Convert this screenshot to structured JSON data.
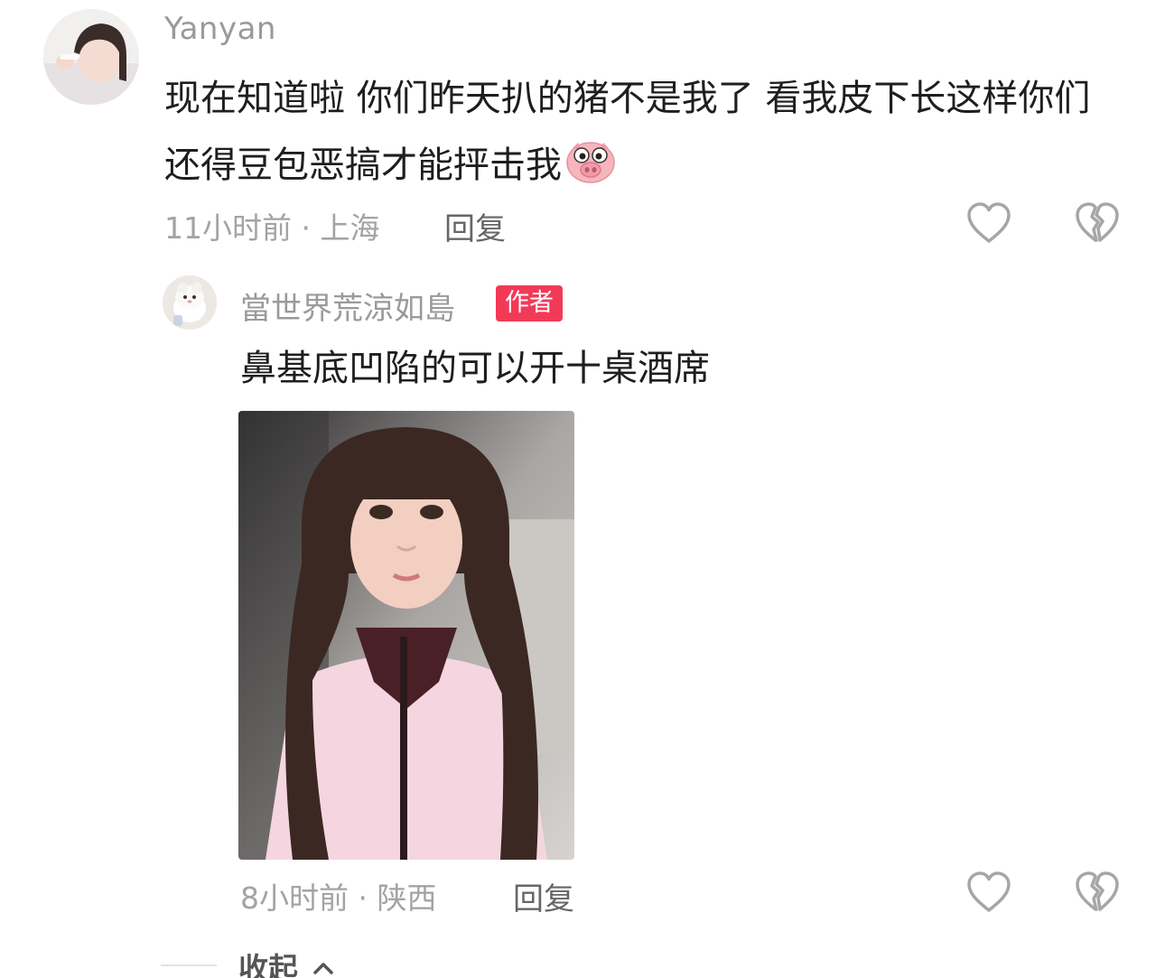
{
  "comment": {
    "username": "Yanyan",
    "text": "现在知道啦 你们昨天扒的猪不是我了 看我皮下长这样你们还得豆包恶搞才能抨击我",
    "emoji": "pig-face",
    "meta": "11小时前 · 上海",
    "reply_label": "回复"
  },
  "reply": {
    "username": "當世界荒涼如島",
    "badge": "作者",
    "text": "鼻基底凹陷的可以开十桌酒席",
    "meta": "8小时前 · 陕西",
    "reply_label": "回复"
  },
  "collapse_label": "收起",
  "icons": {
    "like": "heart-outline-icon",
    "dislike": "broken-heart-icon",
    "collapse": "chevron-up-icon"
  },
  "colors": {
    "author_badge": "#f23a57",
    "muted_text": "#a3a3a3"
  }
}
